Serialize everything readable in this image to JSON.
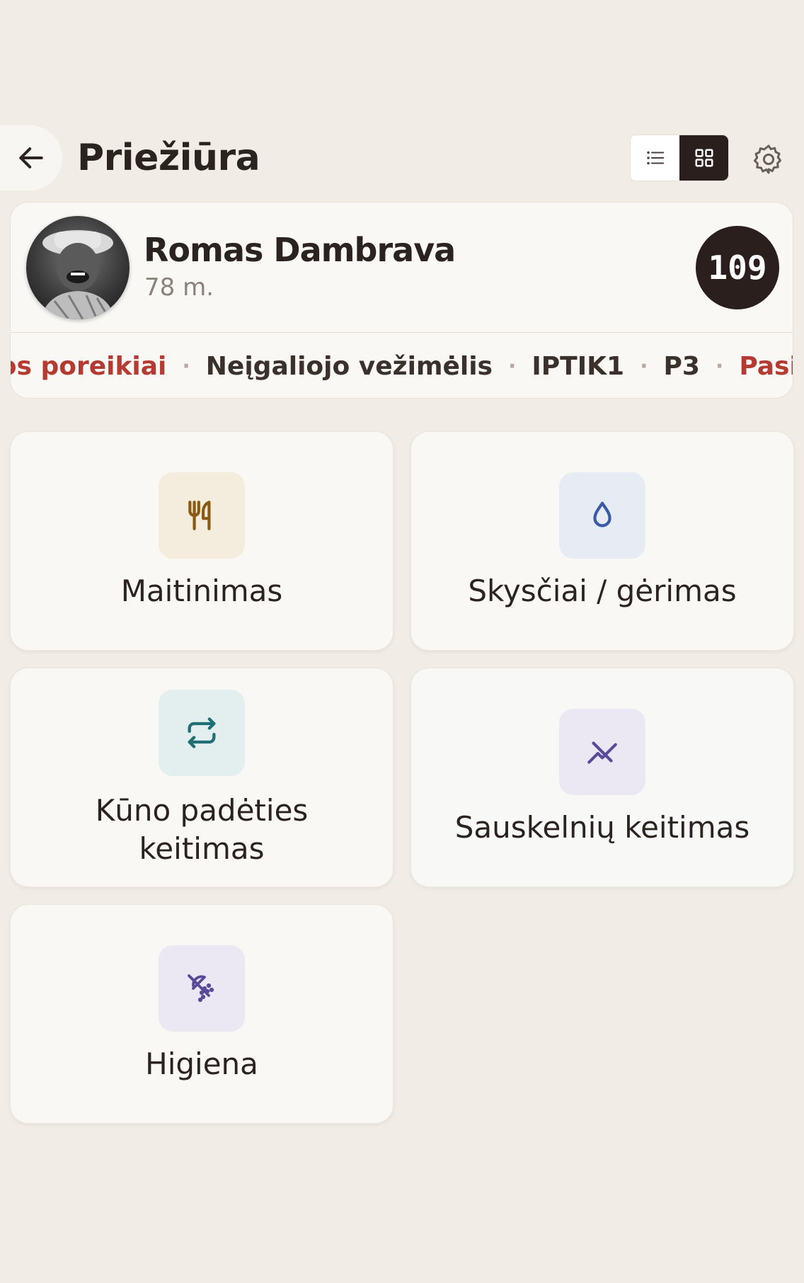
{
  "header": {
    "title": "Priežiūra",
    "back_icon": "arrow-left-icon",
    "view_list_icon": "list-icon",
    "view_grid_icon": "grid-icon",
    "active_view": "grid",
    "settings_icon": "gear-icon"
  },
  "patient": {
    "name": "Romas Dambrava",
    "age": "78 m.",
    "room": "109",
    "tags": [
      {
        "label": "bos poreikiai",
        "alert": true
      },
      {
        "label": "Neįgaliojo vežimėlis",
        "alert": false
      },
      {
        "label": "IPTIK1",
        "alert": false
      },
      {
        "label": "P3",
        "alert": false
      },
      {
        "label": "Pasišal",
        "alert": true
      }
    ],
    "tag_separator": "·"
  },
  "tiles": [
    {
      "label": "Maitinimas",
      "icon": "utensils-icon",
      "color": "#8a5a12",
      "bg": "#f4ecdc"
    },
    {
      "label": "Skysčiai / gėrimas",
      "icon": "droplet-icon",
      "color": "#3a5aa8",
      "bg": "#e6ebf4"
    },
    {
      "label": "Kūno padėties",
      "label_line2": "keitimas",
      "icon": "repeat-icon",
      "color": "#1f6f74",
      "bg": "#e2efee"
    },
    {
      "label": "Sauskelnių keitimas",
      "icon": "diaper-icon",
      "color": "#5a4a9a",
      "bg": "#ebe8f4"
    },
    {
      "label": "Higiena",
      "icon": "shower-icon",
      "color": "#5a4a9a",
      "bg": "#ebe8f4"
    }
  ],
  "colors": {
    "background": "#f1ece6",
    "card": "#faf8f4",
    "dark": "#2a1f1c",
    "alert": "#b43a32"
  }
}
